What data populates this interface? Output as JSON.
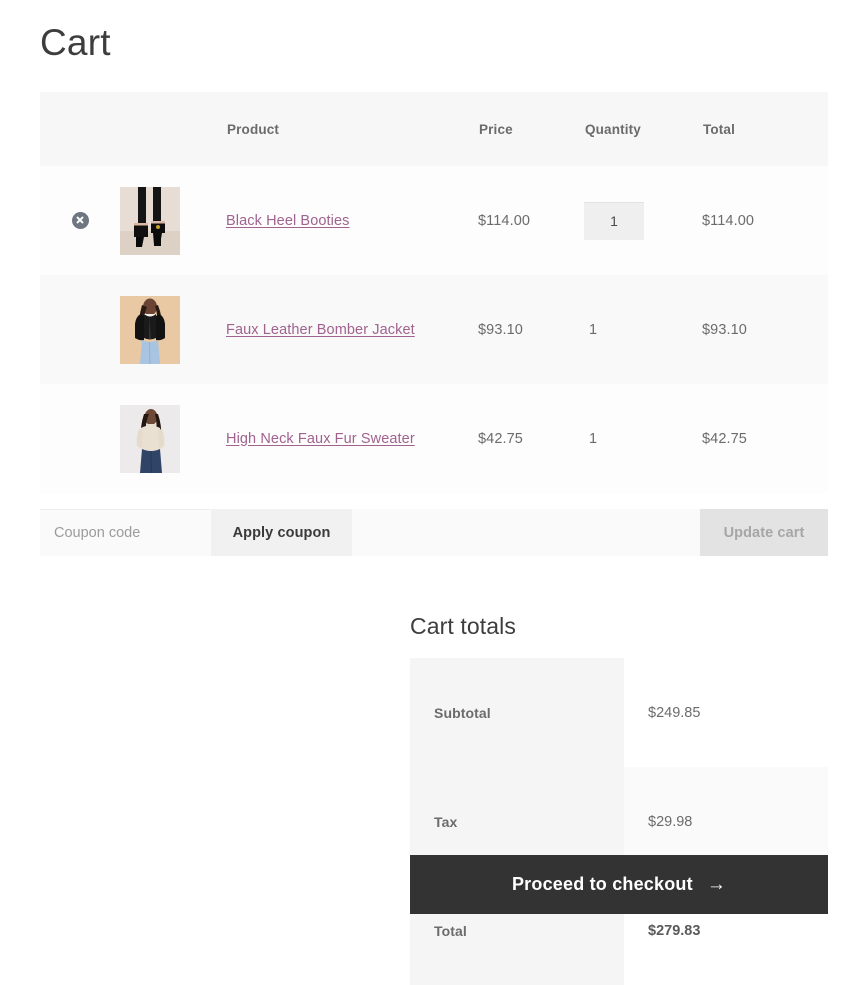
{
  "page": {
    "title": "Cart"
  },
  "cart_table": {
    "columns": [
      "",
      "",
      "Product",
      "Price",
      "Quantity",
      "Total"
    ],
    "headers": {
      "product": "Product",
      "price": "Price",
      "quantity": "Quantity",
      "total": "Total"
    },
    "items": [
      {
        "name": "Black Heel Booties",
        "price": "$114.00",
        "quantity": "1",
        "total": "$114.00",
        "removable": true,
        "quantity_editable": true,
        "thumbnail": "black-heel-booties-thumbnail"
      },
      {
        "name": "Faux Leather Bomber Jacket",
        "price": "$93.10",
        "quantity": "1",
        "total": "$93.10",
        "removable": false,
        "quantity_editable": false,
        "thumbnail": "faux-leather-bomber-jacket-thumbnail"
      },
      {
        "name": "High Neck Faux Fur Sweater",
        "price": "$42.75",
        "quantity": "1",
        "total": "$42.75",
        "removable": false,
        "quantity_editable": false,
        "thumbnail": "high-neck-faux-fur-sweater-thumbnail"
      }
    ]
  },
  "actions": {
    "coupon_placeholder": "Coupon code",
    "coupon_value": "",
    "apply_coupon_label": "Apply coupon",
    "update_cart_label": "Update cart",
    "update_cart_disabled": true
  },
  "cart_totals": {
    "heading": "Cart totals",
    "rows": [
      {
        "label": "Subtotal",
        "value": "$249.85"
      },
      {
        "label": "Tax",
        "value": "$29.98"
      },
      {
        "label": "Total",
        "value": "$279.83"
      }
    ],
    "checkout_label": "Proceed to checkout",
    "checkout_arrow": "→"
  },
  "colors": {
    "link": "#a0628f",
    "header_band": "#f7f7f7",
    "checkout_bg": "#333333",
    "remove_icon": "#6e7682",
    "totals_label_bg": "#f5f5f5"
  }
}
